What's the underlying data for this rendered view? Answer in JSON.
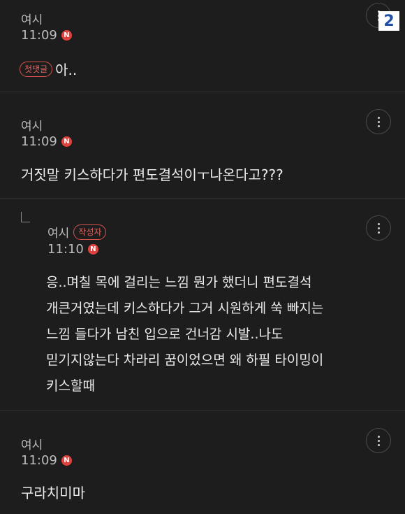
{
  "comments": [
    {
      "author": "여시",
      "time": "11:09",
      "badge": "N",
      "tag": "첫댓글",
      "text": "아.."
    },
    {
      "author": "여시",
      "time": "11:09",
      "badge": "N",
      "text": "거짓말 키스하다가 편도결석이ㅜ나온다고???"
    },
    {
      "author": "여시",
      "author_tag": "작성자",
      "time": "11:10",
      "badge": "N",
      "lines": [
        "응..며칠 목에 걸리는 느낌 뭔가 했더니 편도결석",
        "개큰거였는데 키스하다가 그거 시원하게 쑥 빠지는",
        "느낌 들다가 남친 입으로 건너감 시발..나도",
        "믿기지않는다 차라리 꿈이었으면 왜 하필 타이밍이",
        "키스할때"
      ]
    },
    {
      "author": "여시",
      "time": "11:09",
      "badge": "N",
      "text": "구라치미마"
    }
  ],
  "page_badge": "2",
  "icons": {
    "more": "more-vertical-icon",
    "reply": "reply-arrow-icon"
  }
}
